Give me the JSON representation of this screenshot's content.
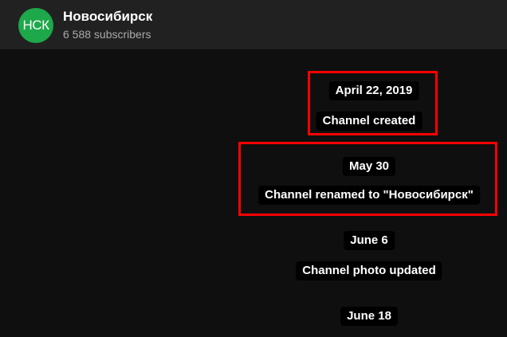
{
  "header": {
    "avatar_text": "НСК",
    "channel_name": "Новосибирск",
    "subscribers": "6 588 subscribers"
  },
  "timeline": [
    {
      "date": "April 22, 2019",
      "event": "Channel created"
    },
    {
      "date": "May 30",
      "event": "Channel renamed to \"Новосибирск\""
    },
    {
      "date": "June 6",
      "event": "Channel photo updated"
    },
    {
      "date": "June 18"
    }
  ],
  "colors": {
    "header_bg": "#212121",
    "content_bg": "#0f0f0f",
    "avatar_bg": "#1da84a",
    "highlight": "#ff0000"
  }
}
